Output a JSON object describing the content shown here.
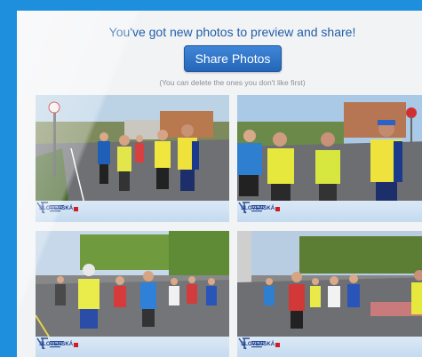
{
  "header": {
    "title": "You've got new photos to preview and share!",
    "share_label": "Share Photos",
    "note": "(You can delete the ones you don't like first)"
  },
  "photos": [
    {
      "brand": "SLOVENSKÁ",
      "alt": "Marathon runners photo 1"
    },
    {
      "brand": "SLOVENSKÁ",
      "alt": "Marathon runners photo 2"
    },
    {
      "brand": "SLOVENSKÁ",
      "alt": "Marathon runners photo 3"
    },
    {
      "brand": "SLOVENSKÁ",
      "alt": "Marathon runners photo 4"
    }
  ],
  "colors": {
    "frame": "#1e8fdc",
    "button": "#2f75c9",
    "headline": "#1f5fa8"
  }
}
